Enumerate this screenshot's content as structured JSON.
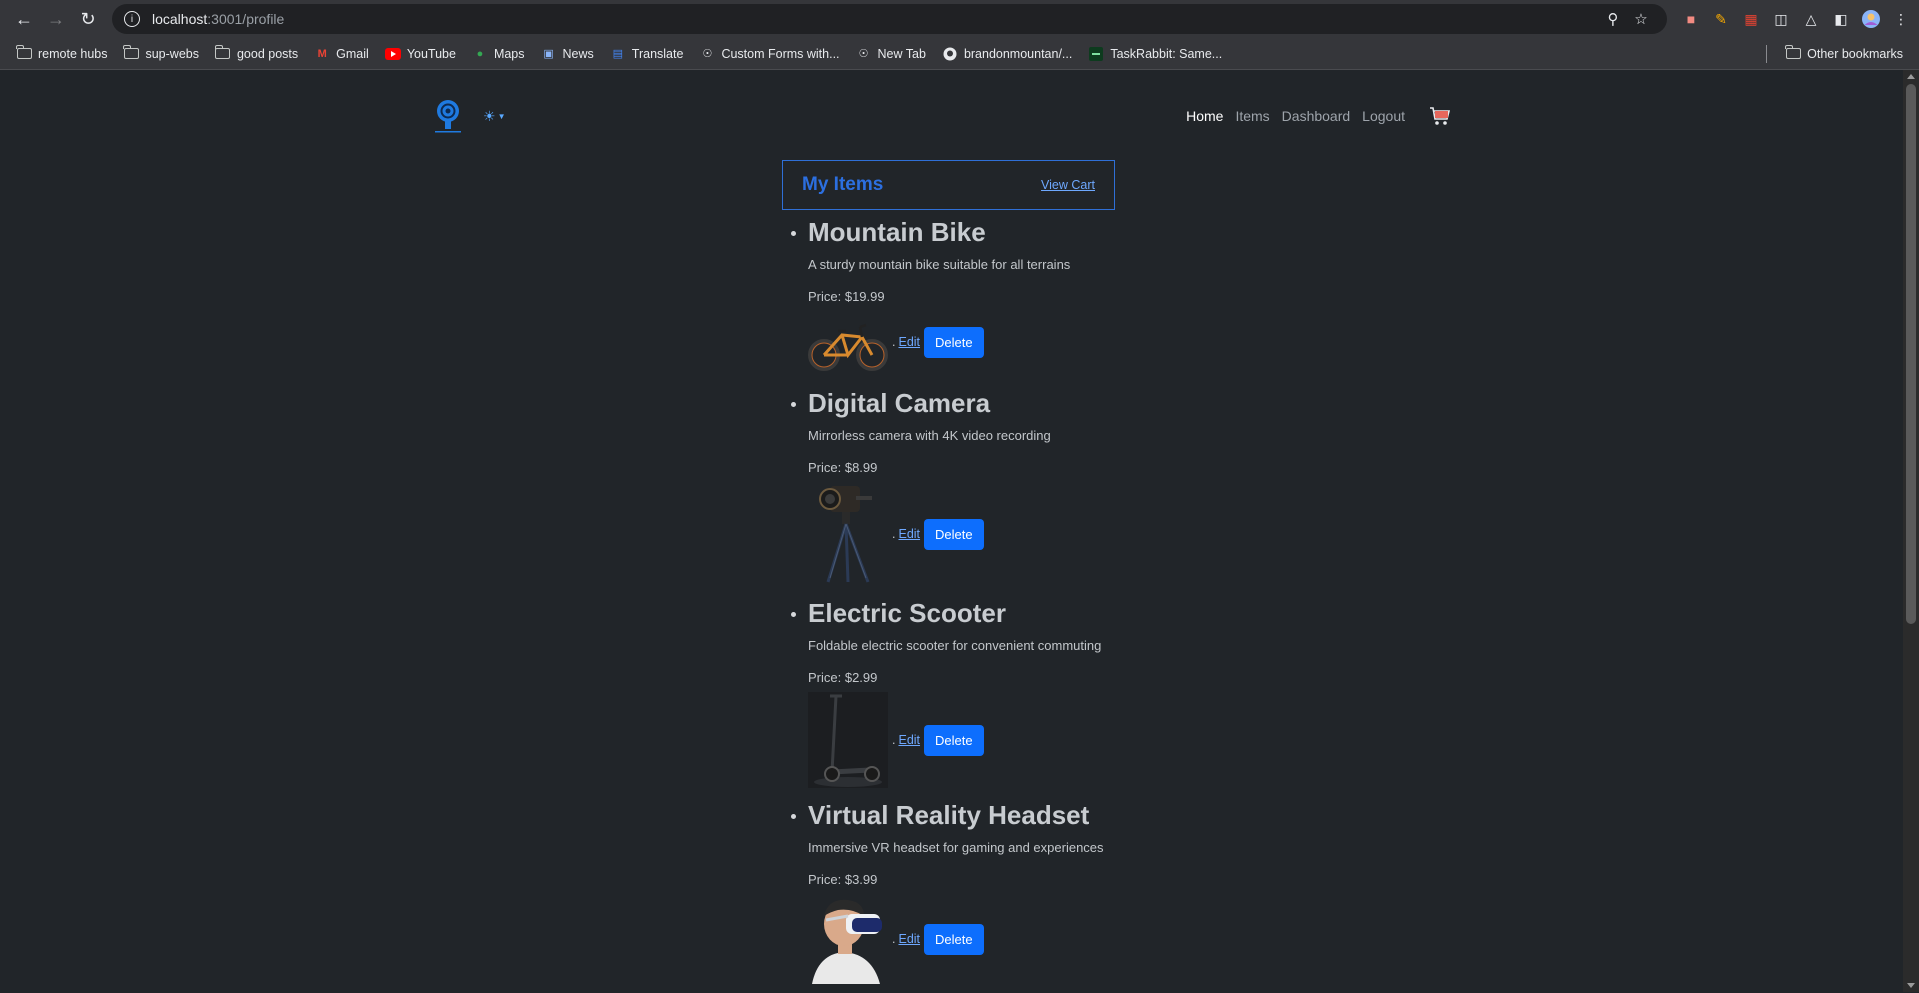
{
  "browser": {
    "url_host": "localhost",
    "url_rest": ":3001/profile",
    "bookmarks": [
      {
        "label": "remote hubs",
        "icon": "folder-icon"
      },
      {
        "label": "sup-webs",
        "icon": "folder-icon"
      },
      {
        "label": "good posts",
        "icon": "folder-icon"
      },
      {
        "label": "Gmail",
        "icon": "gmail-icon"
      },
      {
        "label": "YouTube",
        "icon": "youtube-icon"
      },
      {
        "label": "Maps",
        "icon": "maps-icon"
      },
      {
        "label": "News",
        "icon": "news-icon"
      },
      {
        "label": "Translate",
        "icon": "translate-icon"
      },
      {
        "label": "Custom Forms with...",
        "icon": "globe-icon"
      },
      {
        "label": "New Tab",
        "icon": "globe-icon"
      },
      {
        "label": "brandonmountan/...",
        "icon": "github-icon"
      },
      {
        "label": "TaskRabbit: Same...",
        "icon": "taskrabbit-icon"
      }
    ],
    "other_bookmarks": "Other bookmarks"
  },
  "nav": {
    "links": [
      "Home",
      "Items",
      "Dashboard",
      "Logout"
    ],
    "active": "Home"
  },
  "section": {
    "title": "My Items",
    "view_cart": "View Cart"
  },
  "items": [
    {
      "name": "Mountain Bike",
      "description": "A sturdy mountain bike suitable for all terrains",
      "price": "Price: $19.99",
      "image": "mountain-bike-image",
      "edit": "Edit",
      "delete": "Delete"
    },
    {
      "name": "Digital Camera",
      "description": "Mirrorless camera with 4K video recording",
      "price": "Price: $8.99",
      "image": "camera-on-tripod-image",
      "edit": "Edit",
      "delete": "Delete"
    },
    {
      "name": "Electric Scooter",
      "description": "Foldable electric scooter for convenient commuting",
      "price": "Price: $2.99",
      "image": "electric-scooter-image",
      "edit": "Edit",
      "delete": "Delete"
    },
    {
      "name": "Virtual Reality Headset",
      "description": "Immersive VR headset for gaming and experiences",
      "price": "Price: $3.99",
      "image": "vr-headset-image",
      "edit": "Edit",
      "delete": "Delete"
    }
  ],
  "colors": {
    "page_bg": "#212529",
    "accent": "#0d6efd",
    "link": "#6ea8fe"
  }
}
